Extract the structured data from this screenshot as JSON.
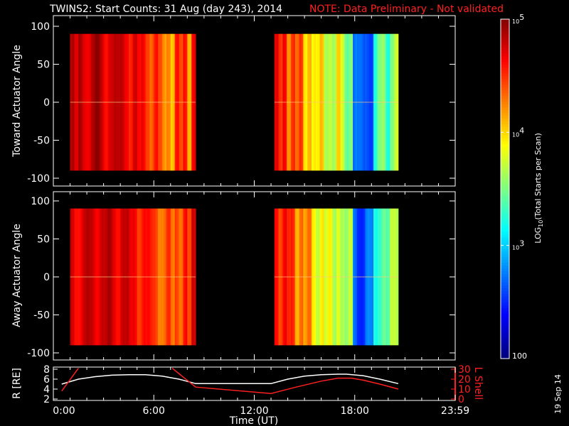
{
  "title": "TWINS2: Start Counts: 31 Aug (day 243), 2014",
  "note": "NOTE: Data Preliminary - Not validated",
  "footer_date": "19 Sep 14",
  "colors": {
    "background": "#000000",
    "axes": "#ffffff",
    "note": "#ff2020",
    "l_shell": "#ff2020",
    "r_line": "#ffffff"
  },
  "chart_data": [
    {
      "type": "heatmap",
      "name": "toward",
      "ylabel": "Toward Actuator Angle",
      "ylim": [
        -110,
        112
      ],
      "yticks": [
        "100",
        "50",
        "0",
        "-50",
        "-100"
      ],
      "ytick_values": [
        100,
        50,
        0,
        -50,
        -100
      ],
      "angle_range": [
        -90,
        90
      ],
      "segments": [
        {
          "start_hour": 1.0,
          "end_hour": 8.5,
          "log_counts": [
            4.8,
            4.6,
            4.85,
            4.8,
            4.75,
            4.8,
            4.85,
            4.8,
            4.7,
            4.8,
            4.75,
            4.7,
            4.8,
            4.75,
            4.6,
            4.7,
            4.5,
            4.65,
            4.55,
            4.4,
            4.5,
            4.3,
            4.2,
            4.35,
            4.1,
            4.5,
            4.3,
            4.6,
            4.2,
            4.7
          ]
        },
        {
          "start_hour": 13.2,
          "end_hour": 20.6,
          "log_counts": [
            4.6,
            4.4,
            4.7,
            4.3,
            4.5,
            4.2,
            4.4,
            4.0,
            4.2,
            3.9,
            3.8,
            4.0,
            3.7,
            3.8,
            3.6,
            3.9,
            3.7,
            3.5,
            3.6,
            2.7,
            2.6,
            2.6,
            2.7,
            2.65,
            3.2,
            3.4,
            3.5,
            3.3,
            3.6,
            3.7
          ]
        }
      ]
    },
    {
      "type": "heatmap",
      "name": "away",
      "ylabel": "Away Actuator Angle",
      "ylim": [
        -110,
        112
      ],
      "yticks": [
        "100",
        "50",
        "0",
        "-50",
        "-100"
      ],
      "ytick_values": [
        100,
        50,
        0,
        -50,
        -100
      ],
      "angle_range": [
        -90,
        90
      ],
      "segments": [
        {
          "start_hour": 1.0,
          "end_hour": 8.5,
          "log_counts": [
            4.8,
            4.7,
            4.65,
            4.7,
            4.75,
            4.8,
            4.75,
            4.8,
            4.7,
            4.8,
            4.75,
            4.7,
            4.8,
            4.7,
            4.6,
            4.7,
            4.55,
            4.6,
            4.5,
            4.45,
            4.5,
            4.35,
            4.3,
            4.4,
            4.2,
            4.5,
            4.4,
            4.6,
            4.3,
            4.7
          ]
        },
        {
          "start_hour": 13.2,
          "end_hour": 20.6,
          "log_counts": [
            4.7,
            4.5,
            4.6,
            4.4,
            4.5,
            4.2,
            4.4,
            4.1,
            4.2,
            3.9,
            3.8,
            4.0,
            3.7,
            3.8,
            3.6,
            3.9,
            3.7,
            3.5,
            3.6,
            2.7,
            2.6,
            2.55,
            2.7,
            2.65,
            3.2,
            3.4,
            3.5,
            3.3,
            3.6,
            3.7
          ]
        }
      ]
    },
    {
      "type": "line",
      "name": "orbit",
      "xlabel": "Time (UT)",
      "xticks": [
        "0:00",
        "6:00",
        "12:00",
        "18:00",
        "23:59"
      ],
      "xtick_values": [
        0,
        6,
        12,
        18,
        24
      ],
      "xlim": [
        0,
        24
      ],
      "ylabel": "R [RE]",
      "yticks": [
        "8",
        "6",
        "4",
        "2"
      ],
      "ylim": [
        2,
        8
      ],
      "y2label": "L Shell",
      "y2ticks": [
        "30",
        "20",
        "10",
        "0"
      ],
      "y2lim": [
        0,
        30
      ],
      "series": [
        {
          "name": "R",
          "axis": "left",
          "x": [
            0.5,
            1.5,
            2.5,
            3.5,
            4.5,
            5.5,
            6.5,
            7.5,
            8.5,
            10,
            12,
            13,
            14,
            15,
            16,
            17,
            17.5,
            18.5,
            19.5,
            20.6
          ],
          "y": [
            5.0,
            6.0,
            6.5,
            6.8,
            6.9,
            6.9,
            6.6,
            6.0,
            5.1,
            5.1,
            5.1,
            5.1,
            6.0,
            6.6,
            6.9,
            7.0,
            7.0,
            6.7,
            6.0,
            5.1
          ]
        },
        {
          "name": "L Shell",
          "axis": "right",
          "x": [
            0.5,
            1.5
          ],
          "y": [
            8,
            31
          ]
        },
        {
          "name": "L Shell",
          "axis": "right",
          "x": [
            7.1,
            8.5,
            13.0,
            14.5,
            16.0,
            17.0,
            17.8,
            18.5,
            19.5,
            20.6
          ],
          "y": [
            31,
            12,
            5.5,
            12,
            18,
            21,
            21,
            19,
            15,
            10
          ]
        }
      ]
    },
    {
      "type": "colorbar",
      "label": "LOG10(Total Starts per Scan)",
      "label_main": "LOG",
      "label_sub": "10",
      "label_rest": "(Total Starts per Scan)",
      "range_log": [
        2,
        5
      ],
      "ticks": [
        {
          "base": "10",
          "exp": "5",
          "value": 5
        },
        {
          "base": "10",
          "exp": "4",
          "value": 4
        },
        {
          "base": "10",
          "exp": "3",
          "value": 3
        },
        {
          "base": "100",
          "exp": "",
          "value": 2
        }
      ]
    }
  ]
}
